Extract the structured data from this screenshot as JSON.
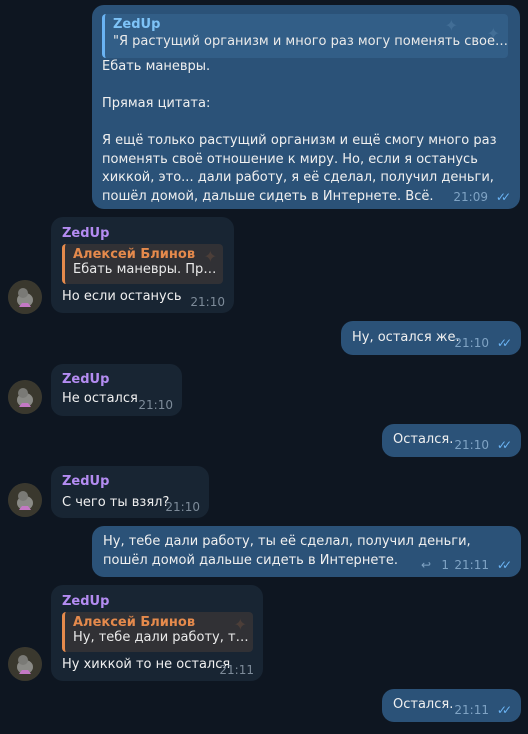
{
  "messages": {
    "m1": {
      "quote_name": "ZedUp",
      "quote_text": "\"Я растущий организм и много раз могу поменять свое мне...",
      "text": "Ебать маневры.\n\nПрямая цитата:\n\nЯ ещё только растущий организм и ещё смогу много раз поменять своё отношение к миру. Но, если я останусь хиккой, это... дали работу, я её сделал, получил деньги, пошёл домой, дальше сидеть в Интернете. Всё.",
      "time": "21:09"
    },
    "m2": {
      "sender": "ZedUp",
      "quote_name": "Алексей Блинов",
      "quote_text": "Ебать маневры.  Пря...",
      "text": "Но если останусь",
      "time": "21:10"
    },
    "m3": {
      "text": "Ну, остался же.",
      "time": "21:10"
    },
    "m4": {
      "sender": "ZedUp",
      "text": "Не остался",
      "time": "21:10"
    },
    "m5": {
      "text": "Остался.",
      "time": "21:10"
    },
    "m6": {
      "sender": "ZedUp",
      "text": "С чего ты взял?",
      "time": "21:10"
    },
    "m7": {
      "text": "Ну, тебе дали работу, ты её сделал, получил деньги, пошёл домой дальше сидеть в Интернете.",
      "replies": "1",
      "time": "21:11"
    },
    "m8": {
      "sender": "ZedUp",
      "quote_name": "Алексей Блинов",
      "quote_text": "Ну, тебе дали работу, ты е...",
      "text": "Ну хиккой то не остался",
      "time": "21:11"
    },
    "m9": {
      "text": "Остался.",
      "time": "21:11"
    }
  },
  "icons": {
    "read_ticks": "✓✓",
    "reply_arrow": "↩"
  },
  "colors": {
    "background": "#0e1621",
    "outgoing_bubble": "#2b5278",
    "incoming_bubble": "#182533",
    "sender_name": "#b48cf2",
    "quote_orange": "#e58a4c",
    "tick_blue": "#6ab3f3"
  }
}
